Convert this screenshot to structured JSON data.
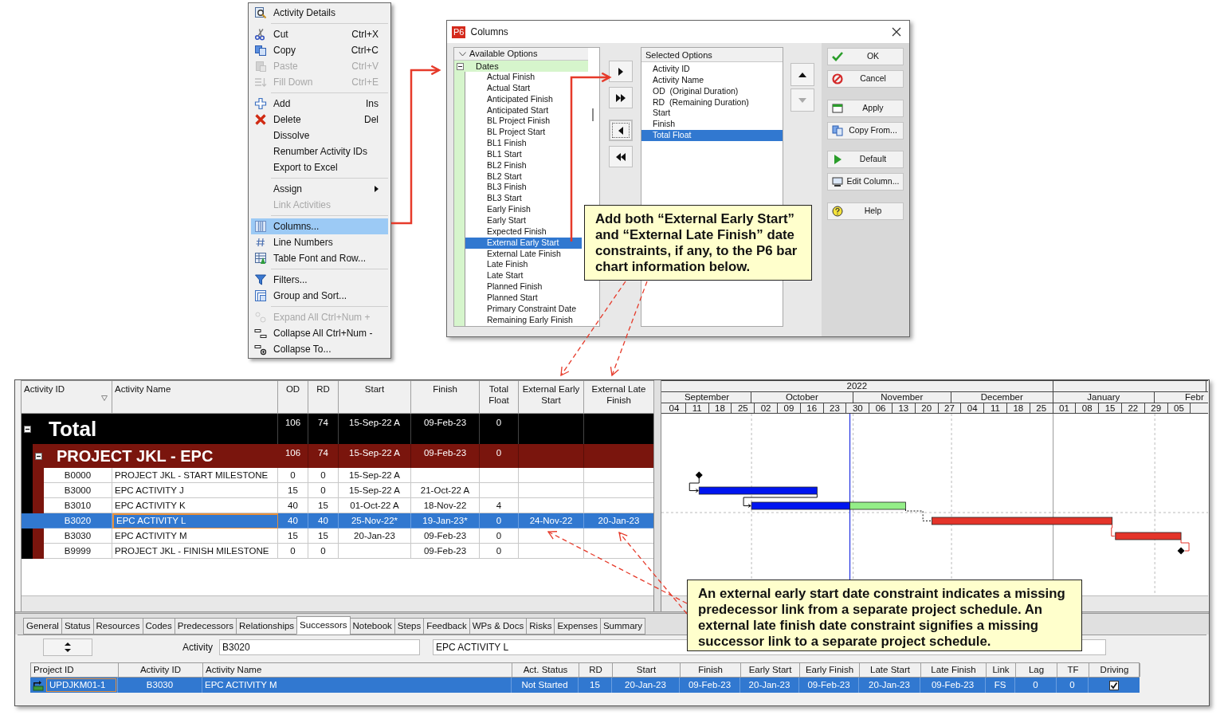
{
  "context_menu": {
    "groups": [
      [
        {
          "label": "Activity Details",
          "disabled": false,
          "selected": false,
          "submenu": false
        }
      ],
      [
        {
          "label": "Cut",
          "shortcut": "Ctrl+X",
          "disabled": false,
          "selected": false,
          "submenu": false
        },
        {
          "label": "Copy",
          "shortcut": "Ctrl+C",
          "disabled": false,
          "selected": false,
          "submenu": false
        },
        {
          "label": "Paste",
          "shortcut": "Ctrl+V",
          "disabled": true,
          "selected": false,
          "submenu": false
        },
        {
          "label": "Fill Down",
          "shortcut": "Ctrl+E",
          "disabled": true,
          "selected": false,
          "submenu": false
        }
      ],
      [
        {
          "label": "Add",
          "shortcut": "Ins",
          "disabled": false,
          "selected": false,
          "submenu": false
        },
        {
          "label": "Delete",
          "shortcut": "Del",
          "disabled": false,
          "selected": false,
          "submenu": false
        },
        {
          "label": "Dissolve",
          "disabled": false,
          "selected": false,
          "submenu": false
        },
        {
          "label": "Renumber Activity IDs",
          "disabled": false,
          "selected": false,
          "submenu": false
        },
        {
          "label": "Export to Excel",
          "disabled": false,
          "selected": false,
          "submenu": false
        }
      ],
      [
        {
          "label": "Assign",
          "disabled": false,
          "selected": false,
          "submenu": true
        },
        {
          "label": "Link Activities",
          "disabled": true,
          "selected": false,
          "submenu": false
        }
      ],
      [
        {
          "label": "Columns...",
          "disabled": false,
          "selected": true,
          "submenu": false
        },
        {
          "label": "Line Numbers",
          "disabled": false,
          "selected": false,
          "submenu": false
        },
        {
          "label": "Table Font and Row...",
          "disabled": false,
          "selected": false,
          "submenu": false
        }
      ],
      [
        {
          "label": "Filters...",
          "disabled": false,
          "selected": false,
          "submenu": false
        },
        {
          "label": "Group and Sort...",
          "disabled": false,
          "selected": false,
          "submenu": false
        }
      ],
      [
        {
          "label": "Expand All  Ctrl+Num +",
          "disabled": true,
          "selected": false,
          "submenu": false
        },
        {
          "label": "Collapse All Ctrl+Num -",
          "disabled": false,
          "selected": false,
          "submenu": false
        },
        {
          "label": "Collapse To...",
          "disabled": false,
          "selected": false,
          "submenu": false
        }
      ]
    ]
  },
  "columns_dialog": {
    "logo": "P6",
    "title": "Columns",
    "available": {
      "header": "Available Options",
      "groups": [
        {
          "label": "Dates",
          "expanded": true,
          "items": [
            {
              "label": "Actual Finish",
              "selected": false
            },
            {
              "label": "Actual Start",
              "selected": false
            },
            {
              "label": "Anticipated Finish",
              "selected": false
            },
            {
              "label": "Anticipated Start",
              "selected": false
            },
            {
              "label": "BL Project Finish",
              "selected": false
            },
            {
              "label": "BL Project Start",
              "selected": false
            },
            {
              "label": "BL1 Finish",
              "selected": false
            },
            {
              "label": "BL1 Start",
              "selected": false
            },
            {
              "label": "BL2 Finish",
              "selected": false
            },
            {
              "label": "BL2 Start",
              "selected": false
            },
            {
              "label": "BL3 Finish",
              "selected": false
            },
            {
              "label": "BL3 Start",
              "selected": false
            },
            {
              "label": "Early Finish",
              "selected": false
            },
            {
              "label": "Early Start",
              "selected": false
            },
            {
              "label": "Expected Finish",
              "selected": false
            },
            {
              "label": "External Early Start",
              "selected": true
            },
            {
              "label": "External Late Finish",
              "selected": false
            },
            {
              "label": "Late Finish",
              "selected": false
            },
            {
              "label": "Late Start",
              "selected": false
            },
            {
              "label": "Planned Finish",
              "selected": false
            },
            {
              "label": "Planned Start",
              "selected": false
            },
            {
              "label": "Primary Constraint Date",
              "selected": false
            },
            {
              "label": "Remaining Early Finish",
              "selected": false
            }
          ]
        }
      ]
    },
    "selected_options": {
      "header": "Selected Options",
      "items": [
        {
          "label": "Activity ID",
          "selected": false
        },
        {
          "label": "Activity Name",
          "selected": false
        },
        {
          "label": "OD  (Original Duration)",
          "selected": false
        },
        {
          "label": "RD  (Remaining Duration)",
          "selected": false
        },
        {
          "label": "Start",
          "selected": false
        },
        {
          "label": "Finish",
          "selected": false
        },
        {
          "label": "Total Float",
          "selected": true
        }
      ]
    },
    "move_up_disabled": false,
    "move_down_disabled": true,
    "buttons": [
      {
        "label": "OK"
      },
      {
        "label": "Cancel"
      },
      {
        "label": "Apply"
      },
      {
        "label": "Copy From..."
      },
      {
        "label": "Default"
      },
      {
        "label": "Edit Column..."
      },
      {
        "label": "Help"
      }
    ]
  },
  "activity_table": {
    "columns": [
      {
        "label": "Activity ID"
      },
      {
        "label": "Activity Name"
      },
      {
        "label": "OD"
      },
      {
        "label": "RD"
      },
      {
        "label": "Start"
      },
      {
        "label": "Finish"
      },
      {
        "label": "Total Float"
      },
      {
        "label": "External Early Start"
      },
      {
        "label": "External Late Finish"
      }
    ],
    "rows": [
      {
        "kind": "total",
        "label": "Total",
        "expanded": true,
        "od": "106",
        "rd": "74",
        "start": "15-Sep-22 A",
        "finish": "09-Feb-23",
        "total_float": "0",
        "children": [
          {
            "kind": "project",
            "label": "PROJECT JKL - EPC",
            "expanded": true,
            "od": "106",
            "rd": "74",
            "start": "15-Sep-22 A",
            "finish": "09-Feb-23",
            "total_float": "0",
            "children": [
              {
                "kind": "activity",
                "id": "B0000",
                "name": "PROJECT JKL - START MILESTONE",
                "od": "0",
                "rd": "0",
                "start": "15-Sep-22 A",
                "selected": false
              },
              {
                "kind": "activity",
                "id": "B3000",
                "name": "EPC ACTIVITY J",
                "od": "15",
                "rd": "0",
                "start": "15-Sep-22 A",
                "finish": "21-Oct-22 A",
                "selected": false
              },
              {
                "kind": "activity",
                "id": "B3010",
                "name": "EPC ACTIVITY K",
                "od": "40",
                "rd": "15",
                "start": "01-Oct-22 A",
                "finish": "18-Nov-22",
                "total_float": "4",
                "selected": false
              },
              {
                "kind": "activity",
                "id": "B3020",
                "name": "EPC ACTIVITY L",
                "od": "40",
                "rd": "40",
                "start": "25-Nov-22*",
                "finish": "19-Jan-23*",
                "total_float": "0",
                "ext_early_start": "24-Nov-22",
                "ext_late_finish": "20-Jan-23",
                "selected": true
              },
              {
                "kind": "activity",
                "id": "B3030",
                "name": "EPC ACTIVITY M",
                "od": "15",
                "rd": "15",
                "start": "20-Jan-23",
                "finish": "09-Feb-23",
                "total_float": "0",
                "selected": false
              },
              {
                "kind": "activity",
                "id": "B9999",
                "name": "PROJECT JKL - FINISH MILESTONE",
                "od": "0",
                "rd": "0",
                "finish": "09-Feb-23",
                "total_float": "0",
                "selected": false
              }
            ]
          }
        ]
      }
    ]
  },
  "gantt": {
    "years": [
      {
        "label": "2022",
        "months": [
          {
            "label": "September"
          },
          {
            "label": "October"
          },
          {
            "label": "November"
          },
          {
            "label": "December"
          }
        ]
      },
      {
        "months": [
          {
            "label": "January"
          },
          {
            "label": "Febr"
          }
        ]
      }
    ],
    "weeks": [
      "04",
      "11",
      "18",
      "25",
      "02",
      "09",
      "16",
      "23",
      "30",
      "06",
      "13",
      "20",
      "27",
      "04",
      "11",
      "18",
      "25",
      "01",
      "08",
      "15",
      "22",
      "29",
      "05"
    ]
  },
  "details": {
    "tabs": [
      {
        "label": "General",
        "selected": false
      },
      {
        "label": "Status",
        "selected": false
      },
      {
        "label": "Resources",
        "selected": false
      },
      {
        "label": "Codes",
        "selected": false
      },
      {
        "label": "Predecessors",
        "selected": false
      },
      {
        "label": "Relationships",
        "selected": false
      },
      {
        "label": "Successors",
        "selected": true
      },
      {
        "label": "Notebook",
        "selected": false
      },
      {
        "label": "Steps",
        "selected": false
      },
      {
        "label": "Feedback",
        "selected": false
      },
      {
        "label": "WPs & Docs",
        "selected": false
      },
      {
        "label": "Risks",
        "selected": false
      },
      {
        "label": "Expenses",
        "selected": false
      },
      {
        "label": "Summary",
        "selected": false
      }
    ],
    "activity_label": "Activity",
    "activity_id": "B3020",
    "activity_name": "EPC ACTIVITY L",
    "successors": {
      "columns": [
        {
          "label": "Project ID"
        },
        {
          "label": "Activity ID"
        },
        {
          "label": "Activity Name"
        },
        {
          "label": "Act. Status"
        },
        {
          "label": "RD"
        },
        {
          "label": "Start"
        },
        {
          "label": "Finish"
        },
        {
          "label": "Early Start"
        },
        {
          "label": "Early Finish"
        },
        {
          "label": "Late Start"
        },
        {
          "label": "Late Finish"
        },
        {
          "label": "Link"
        },
        {
          "label": "Lag"
        },
        {
          "label": "TF"
        },
        {
          "label": "Driving"
        }
      ],
      "rows": [
        {
          "project_id": "UPDJKM01-1",
          "activity_id": "B3030",
          "activity_name": "EPC ACTIVITY M",
          "status": "Not Started",
          "rd": "15",
          "start": "20-Jan-23",
          "finish": "09-Feb-23",
          "early_start": "20-Jan-23",
          "early_finish": "09-Feb-23",
          "late_start": "20-Jan-23",
          "late_finish": "09-Feb-23",
          "link": "FS",
          "lag": "0",
          "tf": "0",
          "driving": true,
          "selected": true
        }
      ]
    }
  },
  "callouts": [
    {
      "text": "Add both “External Early Start” and “External Late Finish” date constraints, if any, to the P6 bar chart information below."
    },
    {
      "text": "An external early start date constraint indicates a missing predecessor link from a separate project schedule. An external late finish date constraint signifies a missing successor link to a separate project schedule."
    }
  ]
}
